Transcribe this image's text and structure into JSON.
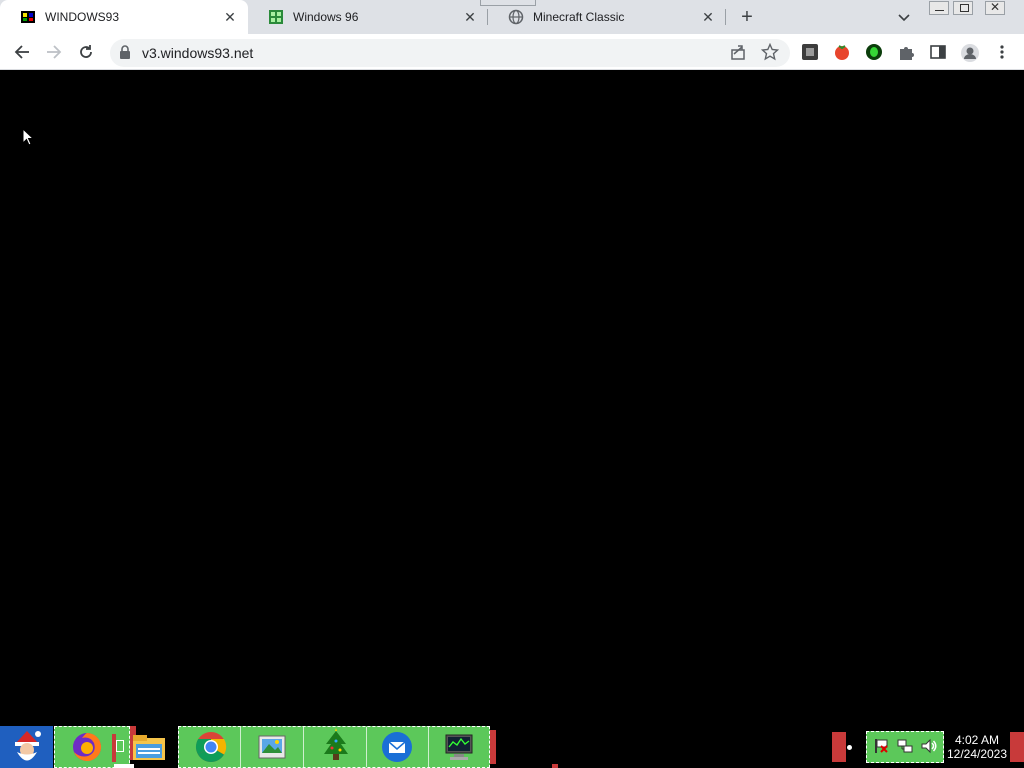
{
  "tabs": [
    {
      "title": "WINDOWS93",
      "active": true,
      "icon": "windows93-favicon"
    },
    {
      "title": "Windows 96",
      "active": false,
      "icon": "windows96-favicon"
    },
    {
      "title": "Minecraft Classic",
      "active": false,
      "icon": "globe-favicon"
    }
  ],
  "toolbar": {
    "url": "v3.windows93.net"
  },
  "taskbar": {
    "pinned": [
      "santa-start-icon",
      "firefox-icon",
      "file-explorer-icon",
      "chrome-icon",
      "photos-icon",
      "christmas-tree-icon",
      "thunderbird-icon",
      "system-monitor-icon"
    ],
    "clock": {
      "time": "4:02 AM",
      "date": "12/24/2023"
    }
  },
  "colors": {
    "tabstrip": "#dee1e6",
    "taskbar_green": "#5cc85a",
    "taskbar_red": "#c83a3a"
  }
}
